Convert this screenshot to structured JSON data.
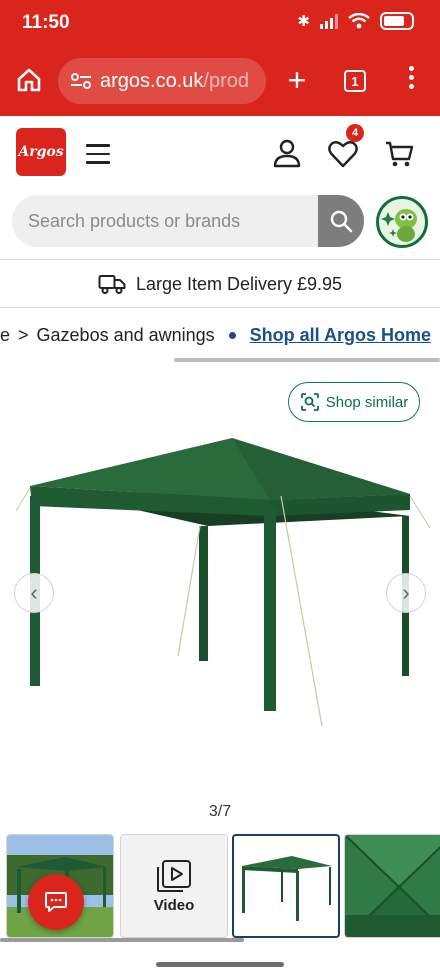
{
  "status_bar": {
    "time": "11:50"
  },
  "browser": {
    "url_host": "argos.co.uk",
    "url_path": "/prod",
    "tab_count": "1"
  },
  "header": {
    "logo_text": "Argos",
    "wishlist_count": "4"
  },
  "search": {
    "placeholder": "Search products or brands"
  },
  "delivery": {
    "text": "Large Item Delivery £9.95"
  },
  "breadcrumb": {
    "previous": "re",
    "current": "Gazebos and awnings",
    "shop_all_link": "Shop all Argos Home"
  },
  "gallery": {
    "shop_similar_label": "Shop similar",
    "counter": "3/7",
    "video_label": "Video"
  },
  "colors": {
    "brand_red": "#d9251c",
    "link_blue": "#1a4f8b",
    "gazebo_green": "#1f5e34"
  }
}
